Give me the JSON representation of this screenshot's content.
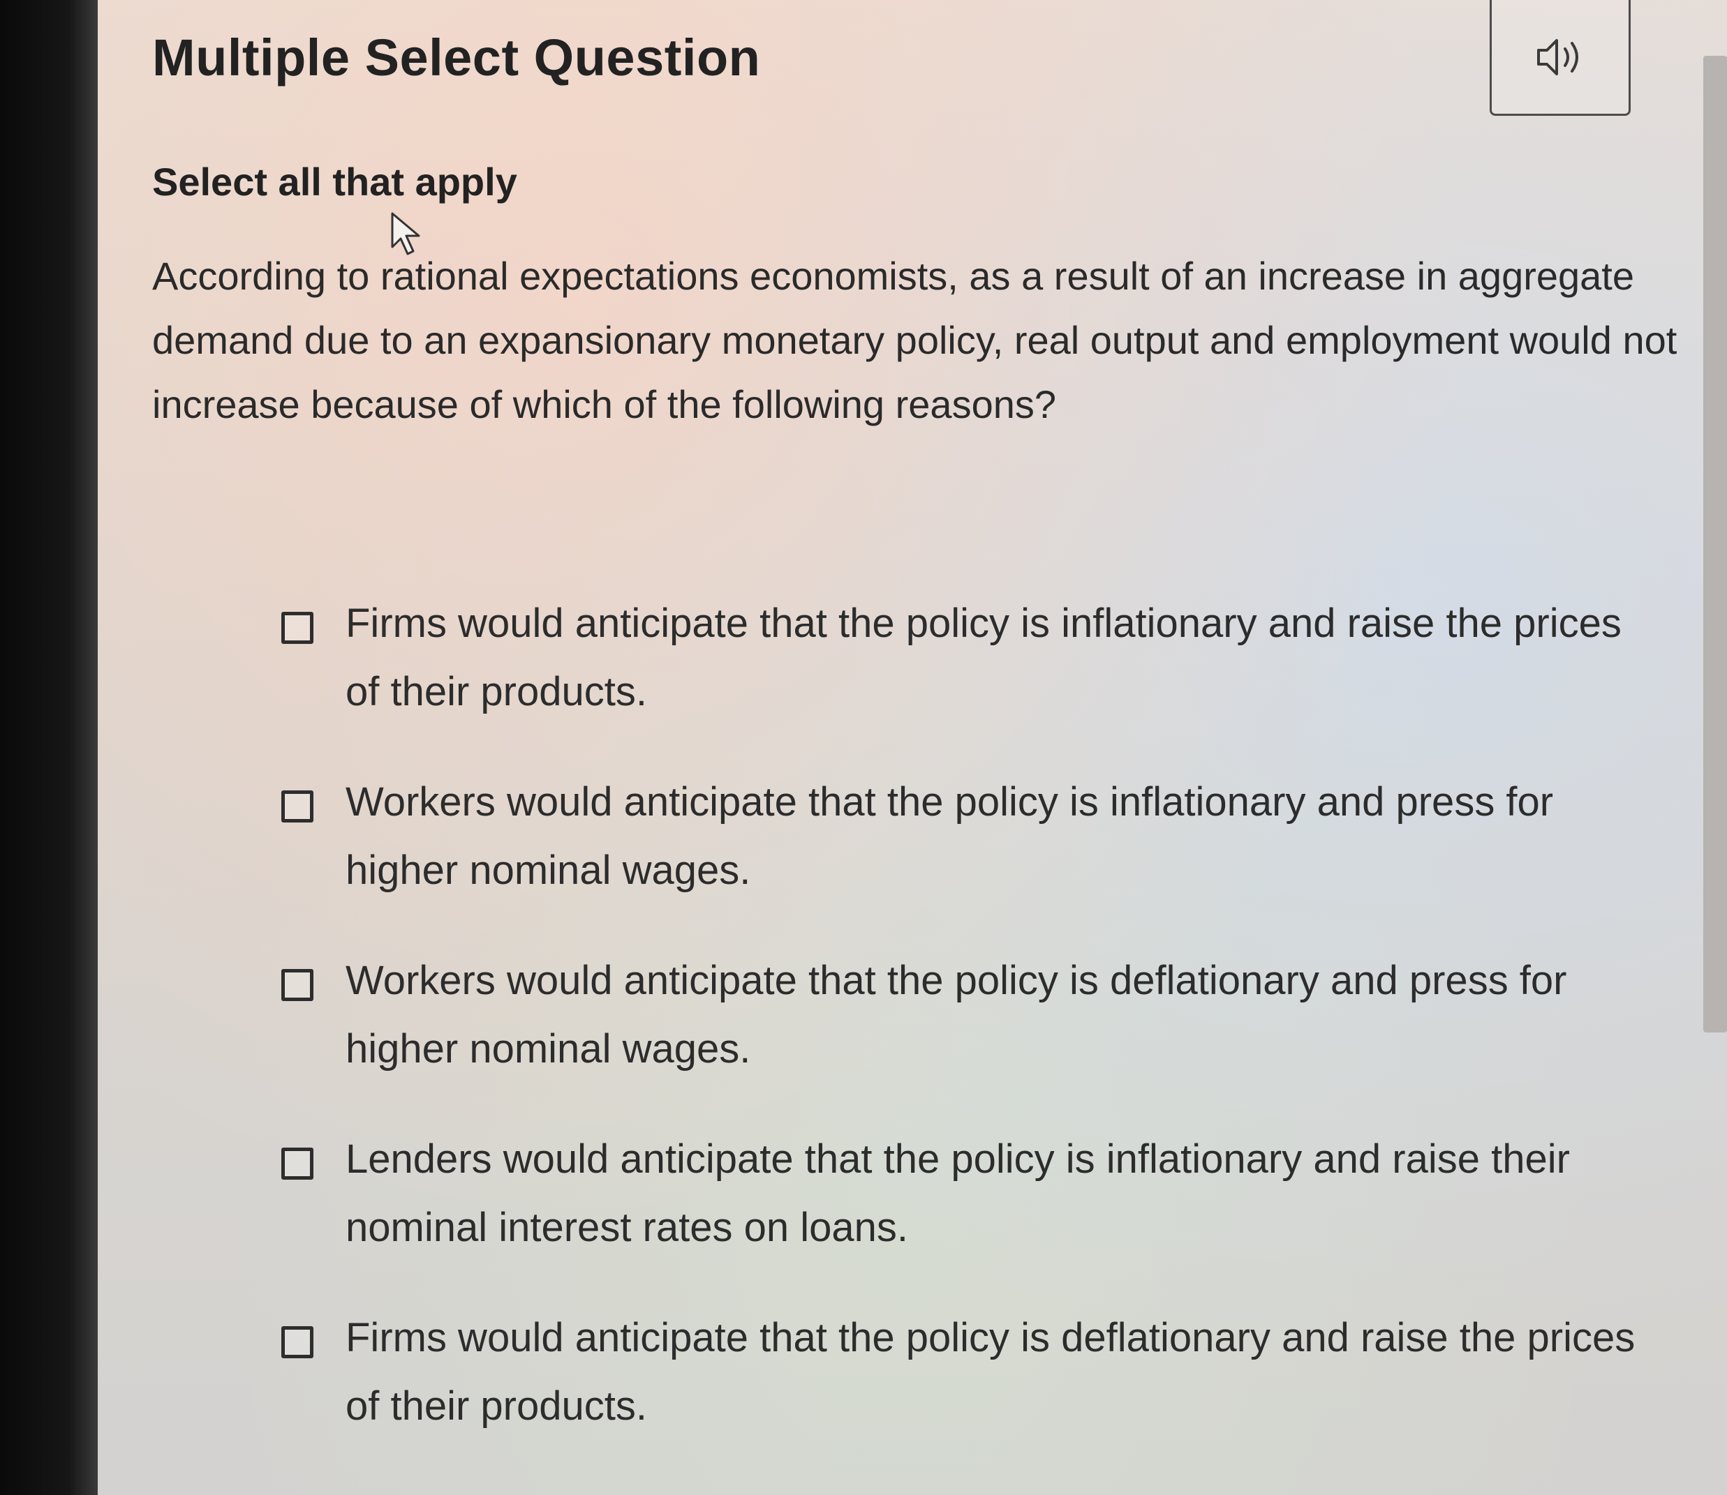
{
  "header": {
    "title": "Multiple Select Question",
    "audio_icon": "speaker-icon"
  },
  "instruction": "Select all that apply",
  "question": "According to rational expectations economists, as a result of an increase in aggregate demand due to an expansionary monetary policy, real output and employment would not increase because of which of the following reasons?",
  "options": [
    {
      "text": "Firms would anticipate that the policy is inflationary and raise the prices of their products.",
      "checked": false
    },
    {
      "text": "Workers would anticipate that the policy is inflationary and press for higher nominal wages.",
      "checked": false
    },
    {
      "text": "Workers would anticipate that the policy is deflationary and press for higher nominal wages.",
      "checked": false
    },
    {
      "text": "Lenders would anticipate that the policy is inflationary and raise their nominal interest rates on loans.",
      "checked": false
    },
    {
      "text": "Firms would anticipate that the policy is deflationary and raise the prices of their products.",
      "checked": false
    }
  ],
  "colors": {
    "text": "#222222",
    "border": "#2d2d2d"
  }
}
